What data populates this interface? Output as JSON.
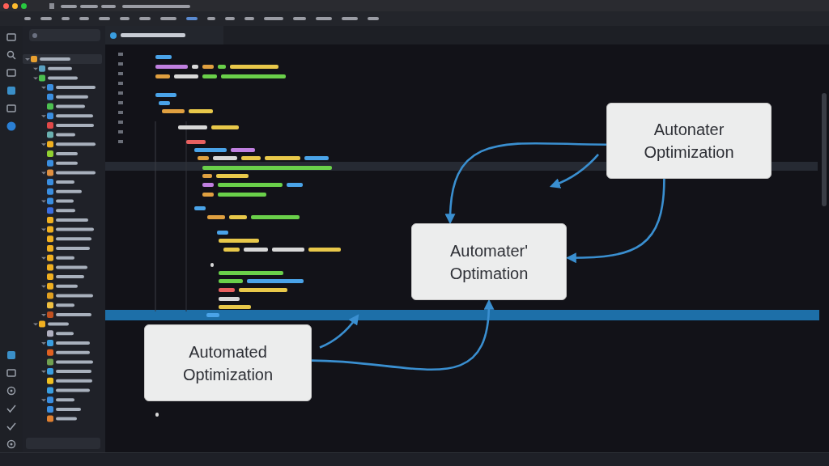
{
  "window": {
    "controls": [
      {
        "color": "#ff5f57"
      },
      {
        "color": "#febc2e"
      },
      {
        "color": "#28c840"
      }
    ]
  },
  "diagram": {
    "nodes": [
      {
        "label": "Autonater Optimization"
      },
      {
        "label": "Automater' Optimation"
      },
      {
        "label": "Automated Optimization"
      }
    ],
    "edges": [
      {
        "kind": "curve"
      },
      {
        "kind": "short"
      },
      {
        "kind": "curve"
      },
      {
        "kind": "short"
      },
      {
        "kind": "curve"
      }
    ]
  }
}
